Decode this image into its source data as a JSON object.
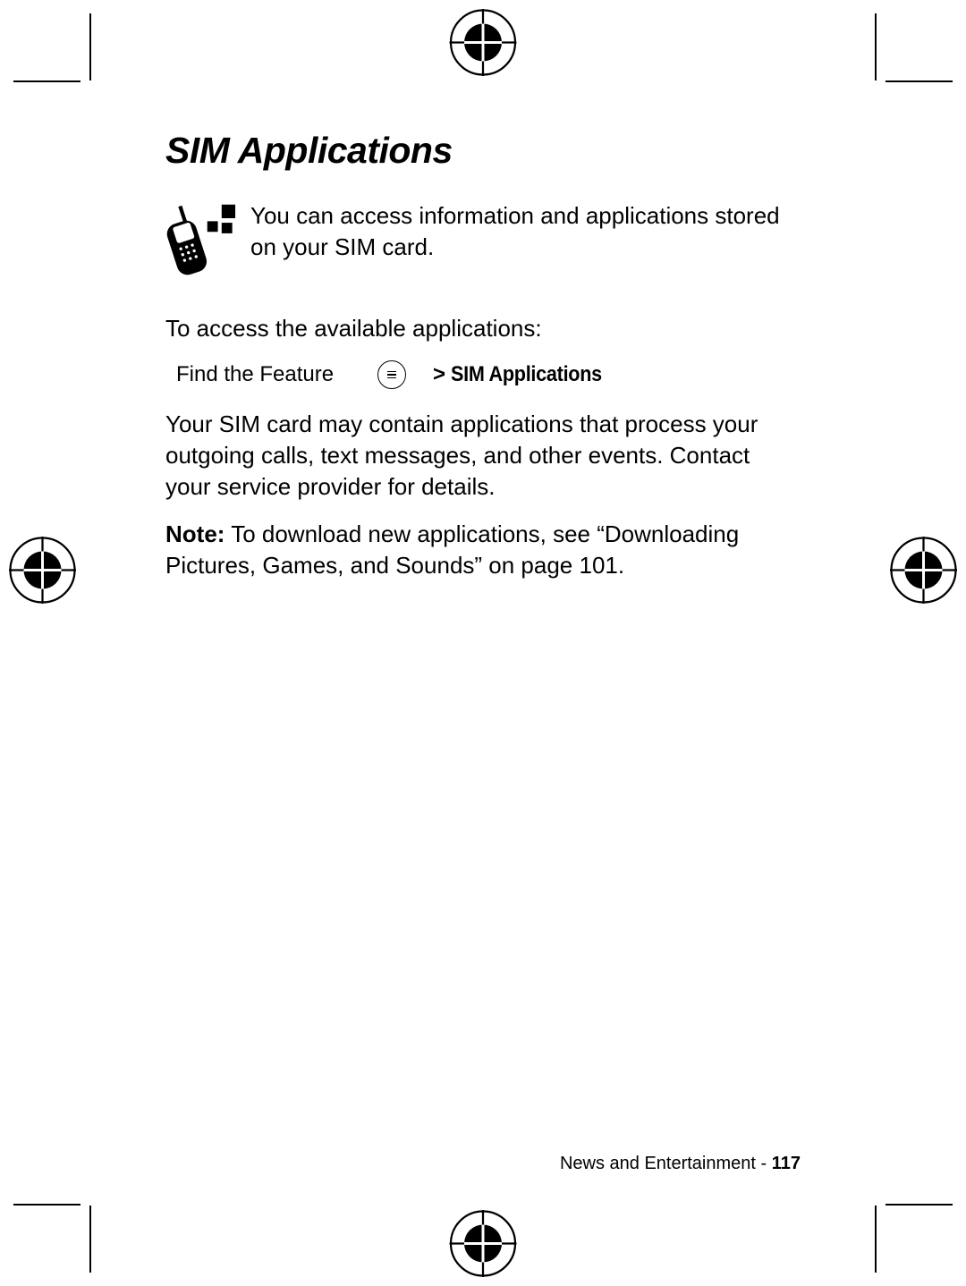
{
  "heading": "SIM Applications",
  "intro": "You can access information and applications stored on your SIM card.",
  "to_access": "To access the available applications:",
  "feature": {
    "find_label": "Find the Feature",
    "arrow": ">",
    "path": "SIM Applications"
  },
  "para2": "Your SIM card may contain applications that process your outgoing calls, text messages, and other events. Contact your service provider for details.",
  "note": {
    "label": "Note:",
    "text": " To download new applications, see “Downloading Pictures, Games, and Sounds” on page 101."
  },
  "footer": {
    "section": "News and Entertainment - ",
    "page": "117"
  }
}
